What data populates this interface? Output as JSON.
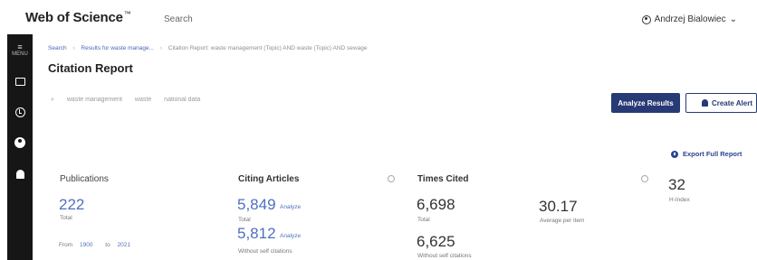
{
  "header": {
    "brand": "Web of Science",
    "brand_mark": "™",
    "search_label": "Search",
    "user_name": "Andrzej Bialowiec"
  },
  "rail": {
    "menu_label": "MENU",
    "icons": [
      "menu-icon",
      "folder-icon",
      "history-icon",
      "user-icon",
      "bell-icon"
    ]
  },
  "breadcrumb": {
    "items": [
      "Search",
      "Results for waste manage...",
      "Citation Report: waste management (Topic) AND waste (Topic) AND sewage"
    ]
  },
  "page_title": "Citation Report",
  "query": {
    "terms": [
      "waste management",
      "waste",
      "national data"
    ]
  },
  "actions": {
    "analyze": "Analyze Results",
    "alert": "Create Alert",
    "export": "Export Full Report"
  },
  "metrics": {
    "publications": {
      "heading": "Publications",
      "total": "222",
      "total_label": "Total",
      "from_label": "From",
      "from_year": "1900",
      "to_label": "to",
      "to_year": "2021"
    },
    "citing": {
      "heading": "Citing Articles",
      "total": "5,849",
      "total_label": "Total",
      "without_self": "5,812",
      "without_self_label": "Without self citations",
      "analyze": "Analyze"
    },
    "times_cited": {
      "heading": "Times Cited",
      "total": "6,698",
      "total_label": "Total",
      "average": "30.17",
      "average_label": "Average per item",
      "without_self": "6,625",
      "without_self_label": "Without self citations"
    },
    "h_index": {
      "value": "32",
      "label": "H-Index"
    }
  },
  "colors": {
    "primary": "#273a75",
    "link": "#4f6fc0",
    "rail": "#161616"
  }
}
